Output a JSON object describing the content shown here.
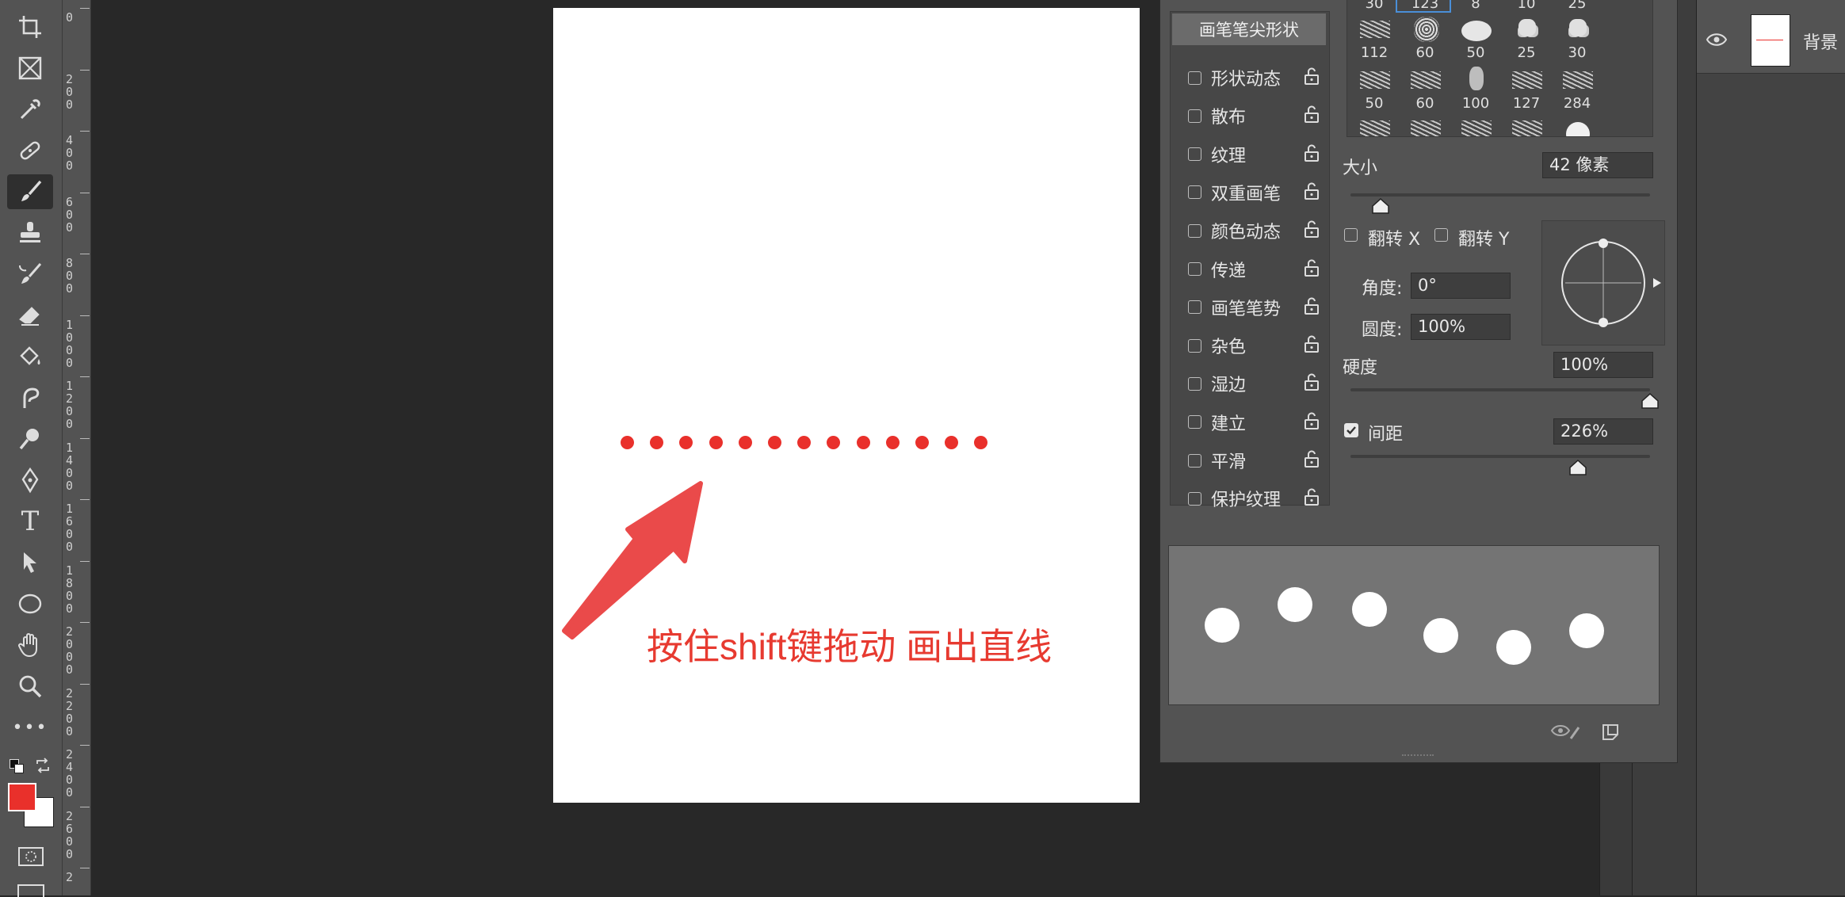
{
  "toolbar": {
    "tools": [
      "crop-icon",
      "frame-icon",
      "eyedropper-icon",
      "healing-brush-icon",
      "brush-icon",
      "clone-stamp-icon",
      "history-brush-icon",
      "eraser-icon",
      "paint-bucket-icon",
      "smudge-icon",
      "dodge-icon",
      "pen-icon",
      "type-icon",
      "path-selection-icon",
      "ellipse-icon",
      "hand-icon",
      "zoom-icon",
      "more-tools-icon"
    ],
    "active_tool": "brush-icon",
    "type_glyph": "T",
    "more_glyph": "•••",
    "foreground_color": "#e9302b",
    "background_color": "#ffffff"
  },
  "ruler": {
    "labels": [
      "0",
      "200",
      "400",
      "600",
      "800",
      "1000",
      "1200",
      "1400",
      "1600",
      "1800",
      "2000",
      "2200",
      "2400",
      "2600",
      "2"
    ]
  },
  "canvas": {
    "background": "#ffffff",
    "dot_color": "#e9302b",
    "dot_count": 13,
    "annotation": "按住shift键拖动 画出直线",
    "annotation_color": "#e73a30"
  },
  "brush_panel": {
    "tip_shape_label": "画笔笔尖形状",
    "options": [
      {
        "label": "形状动态",
        "checked": false
      },
      {
        "label": "散布",
        "checked": false
      },
      {
        "label": "纹理",
        "checked": false
      },
      {
        "label": "双重画笔",
        "checked": false
      },
      {
        "label": "颜色动态",
        "checked": false
      },
      {
        "label": "传递",
        "checked": false
      },
      {
        "label": "画笔笔势",
        "checked": false
      },
      {
        "label": "杂色",
        "checked": false
      },
      {
        "label": "湿边",
        "checked": false
      },
      {
        "label": "建立",
        "checked": false
      },
      {
        "label": "平滑",
        "checked": false
      },
      {
        "label": "保护纹理",
        "checked": false
      }
    ],
    "presets_row0": [
      "30",
      "123",
      "8",
      "10",
      "25"
    ],
    "presets_row1": [
      "112",
      "60",
      "50",
      "25",
      "30"
    ],
    "presets_row2": [
      "50",
      "60",
      "100",
      "127",
      "284"
    ],
    "size_label": "大小",
    "size_value": "42 像素",
    "size_fraction": 0.1,
    "flip_x_label": "翻转 X",
    "flip_y_label": "翻转 Y",
    "angle_label": "角度:",
    "angle_value": "0°",
    "roundness_label": "圆度:",
    "roundness_value": "100%",
    "hardness_label": "硬度",
    "hardness_value": "100%",
    "hardness_fraction": 1.0,
    "spacing_label": "间距",
    "spacing_checked": true,
    "spacing_value": "226%",
    "spacing_fraction": 0.76
  },
  "layers": {
    "layer_name": "背景"
  }
}
